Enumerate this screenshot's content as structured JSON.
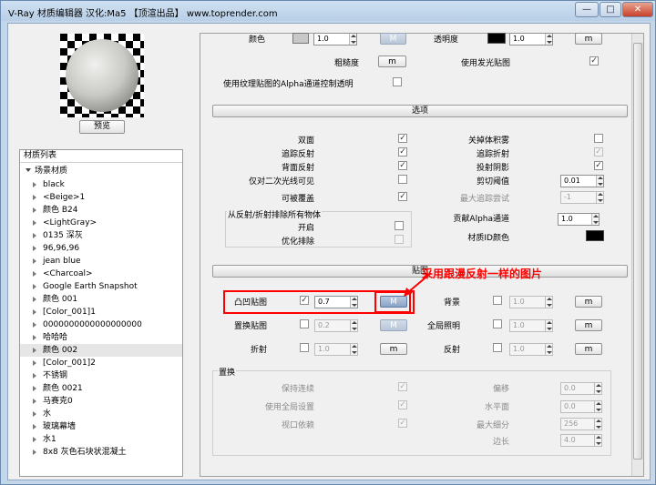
{
  "window": {
    "title": "V-Ray 材质编辑器    汉化:Ma5    【顶渲出品】 www.toprender.com",
    "controls": {
      "minimize": "—",
      "maximize": "□",
      "close": "✕"
    }
  },
  "preview": {
    "button": "预览"
  },
  "material_list": {
    "header": "材质列表",
    "root": "场景材质",
    "items": [
      "black",
      "<Beige>1",
      "颜色 B24",
      "<LightGray>",
      "0135 深灰",
      "96,96,96",
      "jean blue",
      "<Charcoal>",
      "Google Earth Snapshot",
      "颜色 001",
      "[Color_001]1",
      "0000000000000000000",
      "哈哈哈",
      "颜色 002",
      "[Color_001]2",
      "不锈钢",
      "颜色 0021",
      "马赛克0",
      "水",
      "玻璃幕墙",
      "水1",
      "8x8 灰色石块状混凝土"
    ],
    "selected": "颜色 002"
  },
  "top": {
    "color_label": "颜色",
    "color_value": "1.0",
    "color_btn": "M",
    "transparency_label": "透明度",
    "transparency_value": "1.0",
    "transparency_btn": "m",
    "roughness_label": "粗糙度",
    "roughness_btn": "m",
    "use_emissive_label": "使用发光贴图",
    "alpha_label": "使用纹理贴图的Alpha通道控制透明"
  },
  "options": {
    "title": "选项",
    "left": [
      "双面",
      "追踪反射",
      "背面反射",
      "仅对二次光线可见",
      "可被覆盖"
    ],
    "right": [
      "关掉体积雾",
      "追踪折射",
      "投射阴影",
      "剪切阈值",
      "最大追踪尝试"
    ],
    "cutoff_value": "0.01",
    "max_trace_value": "-1",
    "exclude_group": "从反射/折射排除所有物体",
    "exclude_items": [
      "开启",
      "优化排除"
    ],
    "alpha_contrib_label": "贡献Alpha通道",
    "alpha_contrib_value": "1.0",
    "material_id_label": "材质ID颜色"
  },
  "maps": {
    "title": "贴图",
    "bump_label": "凸凹贴图",
    "bump_value": "0.7",
    "bump_btn": "M",
    "displace_label": "置换贴图",
    "displace_value": "0.2",
    "displace_btn": "M",
    "refract_label": "折射",
    "refract_value": "1.0",
    "refract_btn": "m",
    "background_label": "背景",
    "background_value": "1.0",
    "background_btn": "m",
    "gi_label": "全局照明",
    "gi_value": "1.0",
    "gi_btn": "m",
    "reflect_label": "反射",
    "reflect_value": "1.0",
    "reflect_btn": "m"
  },
  "displacement": {
    "title": "置换",
    "keep_continuity": "保持连续",
    "use_global": "使用全局设置",
    "view_dependent": "视口依赖",
    "shift_label": "偏移",
    "shift_value": "0.0",
    "water_label": "水平面",
    "water_value": "0.0",
    "max_subdiv_label": "最大细分",
    "max_subdiv_value": "256",
    "edge_label": "边长",
    "edge_value": "4.0"
  },
  "annotation": {
    "text": "采用跟漫反射一样的图片",
    "color": "#ff0000"
  }
}
